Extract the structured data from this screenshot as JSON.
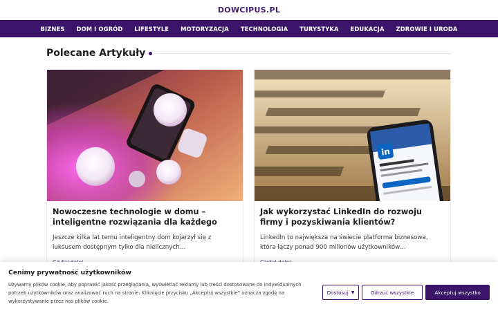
{
  "site": {
    "logo": "DOWCIPUS.PL"
  },
  "nav": {
    "items": [
      {
        "label": "BIZNES"
      },
      {
        "label": "DOM I OGRÓD"
      },
      {
        "label": "LIFESTYLE"
      },
      {
        "label": "MOTORYZACJA"
      },
      {
        "label": "TECHNOLOGIA"
      },
      {
        "label": "TURYSTYKA"
      },
      {
        "label": "EDUKACJA"
      },
      {
        "label": "ZDROWIE I URODA"
      }
    ]
  },
  "section": {
    "title": "Polecane Artykuły"
  },
  "articles": [
    {
      "image": "smart-home-lights-photo",
      "title": "Nowoczesne technologie w domu – inteligentne rozwiązania dla każdego",
      "excerpt": "Jeszcze kilka lat temu inteligentny dom kojarzył się z luksusem dostępnym tylko dla nielicznych…",
      "read_more": "Czytaj dalej…"
    },
    {
      "image": "linkedin-phone-photo",
      "title": "Jak wykorzystać LinkedIn do rozwoju firmy i pozyskiwania klientów?",
      "excerpt": "LinkedIn to największa na świecie platforma biznesowa, która łączy ponad 900 milionów użytkowników…",
      "read_more": "Czytaj dalej…"
    }
  ],
  "cookie_banner": {
    "title": "Cenimy prywatność użytkowników",
    "text": "Używamy plików cookie, aby poprawić jakość przeglądania, wyświetlać reklamy lub treści dostosowane do indywidualnych potrzeb użytkowników oraz analizować ruch na stronie. Kliknięcie przycisku „Akceptuj wszystkie” oznacza zgodę na wykorzystywanie przez nas plików cookie.",
    "customize_label": "Dostosuj",
    "reject_label": "Odrzuć wszystkie",
    "accept_label": "Akceptuj wszystko"
  },
  "colors": {
    "brand": "#3a1469",
    "text": "#1d1d1d"
  }
}
